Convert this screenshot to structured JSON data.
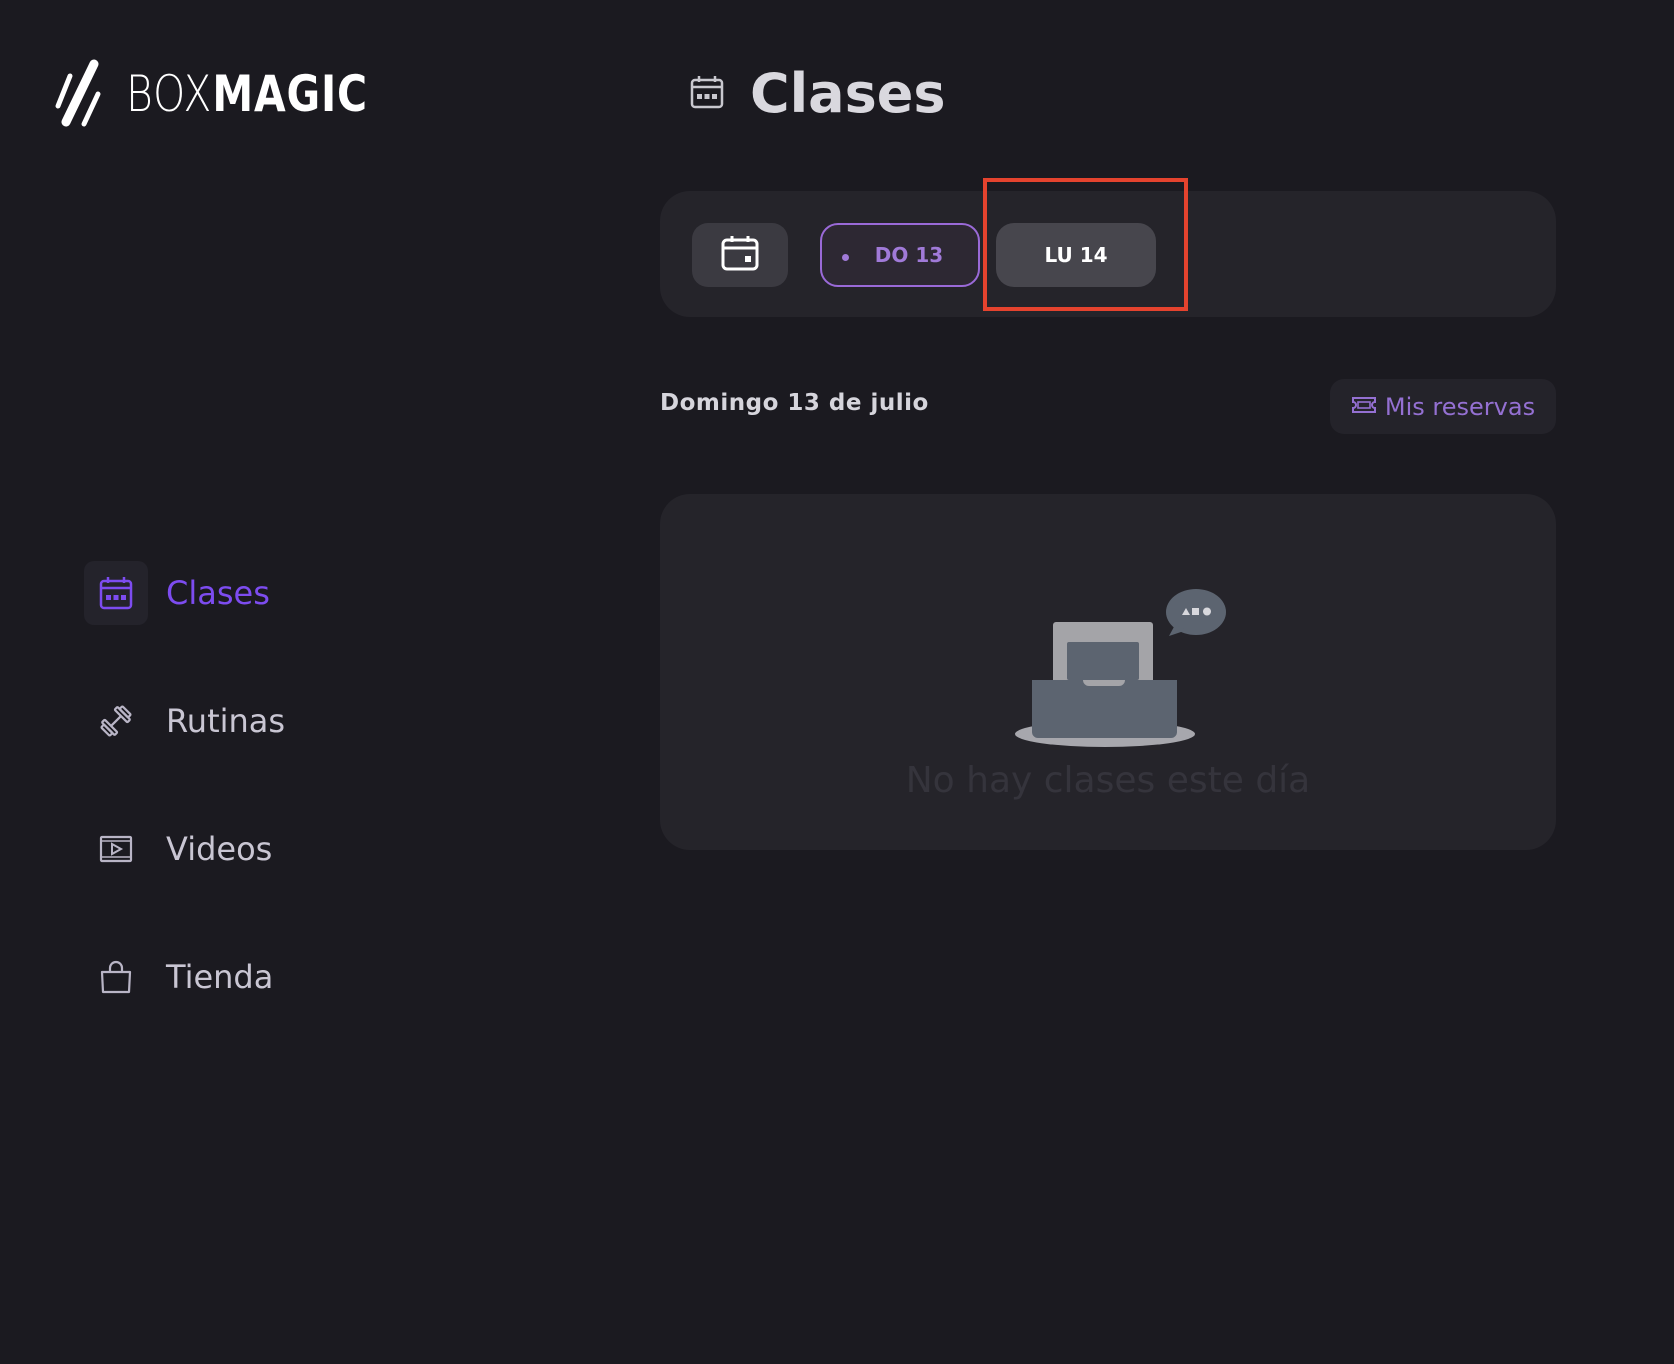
{
  "brand": {
    "name_light": "BOX",
    "name_bold": "MAGIC"
  },
  "sidebar": {
    "items": [
      {
        "label": "Clases",
        "icon": "calendar-icon",
        "active": true
      },
      {
        "label": "Rutinas",
        "icon": "dumbbell-icon",
        "active": false
      },
      {
        "label": "Videos",
        "icon": "video-icon",
        "active": false
      },
      {
        "label": "Tienda",
        "icon": "shopping-bag-icon",
        "active": false
      }
    ]
  },
  "header": {
    "title": "Clases",
    "icon": "calendar-icon"
  },
  "date_strip": {
    "days": [
      {
        "label": "DO 13",
        "selected": true
      },
      {
        "label": "LU 14",
        "selected": false
      }
    ]
  },
  "main": {
    "date_heading": "Domingo 13 de julio",
    "reservas_label": "Mis reservas",
    "empty_message": "No hay clases este día"
  },
  "colors": {
    "background": "#1b1a20",
    "panel": "#25242a",
    "accent": "#7d4cf0",
    "selected_day": "#a07ad8",
    "highlight": "#e5432e"
  }
}
